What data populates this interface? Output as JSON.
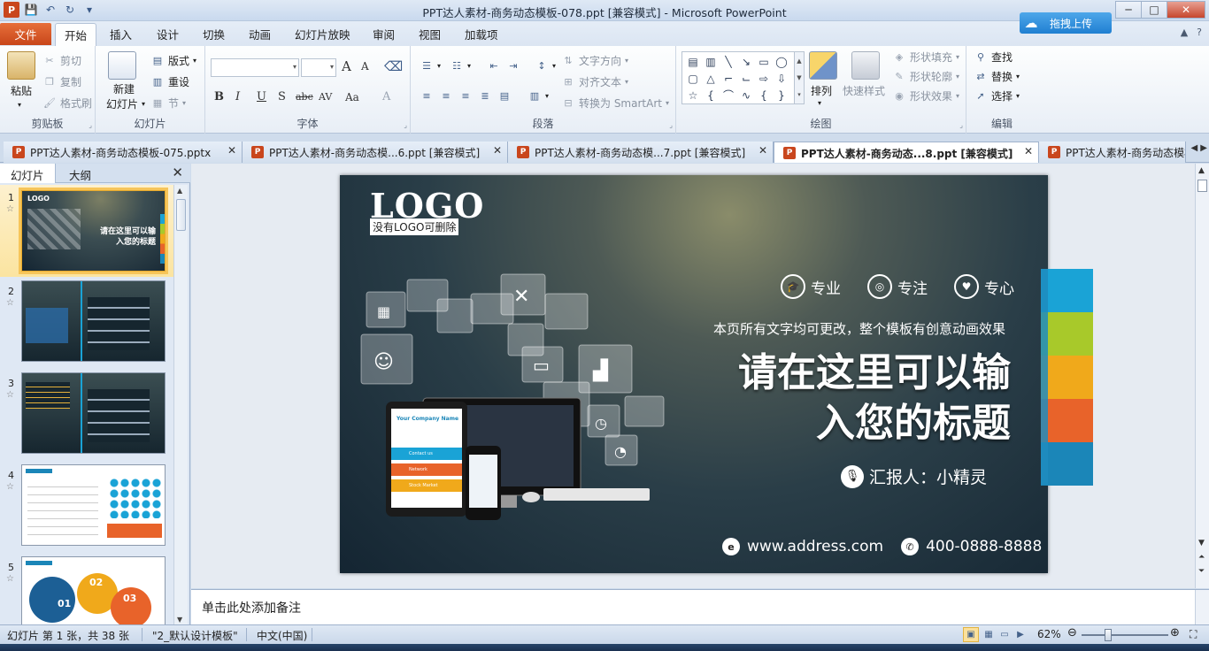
{
  "window": {
    "title": "PPT达人素材-商务动态模板-078.ppt [兼容模式]  -  Microsoft PowerPoint",
    "upload_label": "拖拽上传",
    "min": "─",
    "max": "□",
    "close": "✕"
  },
  "ribbon_tabs": {
    "file": "文件",
    "items": [
      "开始",
      "插入",
      "设计",
      "切换",
      "动画",
      "幻灯片放映",
      "审阅",
      "视图",
      "加载项"
    ]
  },
  "ribbon": {
    "clipboard": {
      "paste": "粘贴",
      "cut": "剪切",
      "copy": "复制",
      "format_painter": "格式刷",
      "label": "剪贴板"
    },
    "slides": {
      "new_slide_1": "新建",
      "new_slide_2": "幻灯片",
      "layout": "版式",
      "reset": "重设",
      "section": "节",
      "label": "幻灯片"
    },
    "font": {
      "label": "字体",
      "bold": "B",
      "italic": "I",
      "underline": "U",
      "shadow": "S",
      "strike": "abc",
      "spacing": "AV",
      "case": "Aa",
      "color": "A",
      "grow": "A",
      "shrink": "A"
    },
    "paragraph": {
      "text_direction": "文字方向",
      "align_text": "对齐文本",
      "smartart": "转换为 SmartArt",
      "label": "段落"
    },
    "drawing": {
      "arrange": "排列",
      "quick_styles": "快速样式",
      "shape_fill": "形状填充",
      "shape_outline": "形状轮廓",
      "shape_effects": "形状效果",
      "label": "绘图"
    },
    "editing": {
      "find": "查找",
      "replace": "替换",
      "select": "选择",
      "label": "编辑"
    }
  },
  "doc_tabs": [
    {
      "label": "PPT达人素材-商务动态模板-075.pptx"
    },
    {
      "label": "PPT达人素材-商务动态模...6.ppt [兼容模式]"
    },
    {
      "label": "PPT达人素材-商务动态模...7.ppt [兼容模式]"
    },
    {
      "label": "PPT达人素材-商务动态...8.ppt [兼容模式]"
    },
    {
      "label": "PPT达人素材-商务动态模板"
    }
  ],
  "left_panel": {
    "tab_slides": "幻灯片",
    "tab_outline": "大纲",
    "slides": [
      {
        "num": "1",
        "star": "☆"
      },
      {
        "num": "2",
        "star": "☆"
      },
      {
        "num": "3",
        "star": "☆"
      },
      {
        "num": "4",
        "star": "☆"
      },
      {
        "num": "5",
        "star": "☆"
      }
    ],
    "thumb1": {
      "title_1": "请在这里可以输",
      "title_2": "入您的标题"
    },
    "thumb5": {
      "n1": "01",
      "n2": "02",
      "n3": "03"
    }
  },
  "slide": {
    "logo": "LOGO",
    "logo_sub": "没有LOGO可删除",
    "values": [
      "专业",
      "专注",
      "专心"
    ],
    "subtitle": "本页所有文字均可更改，整个模板有创意动画效果",
    "title_line1": "请在这里可以输",
    "title_line2": "入您的标题",
    "reporter": "汇报人：小精灵",
    "website": "www.address.com",
    "phone": "400-0888-8888",
    "device_brand": "Your Company Name",
    "menu": [
      "Contact us",
      "Network",
      "Stock Market"
    ],
    "colors": [
      "#1aa3d6",
      "#a8c92a",
      "#f0a91b",
      "#e8632a",
      "#1b86b8"
    ]
  },
  "notes": {
    "placeholder": "单击此处添加备注"
  },
  "status": {
    "slide_info": "幻灯片 第 1 张，共 38 张",
    "theme": "\"2_默认设计模板\"",
    "language": "中文(中国)",
    "zoom": "62%"
  }
}
